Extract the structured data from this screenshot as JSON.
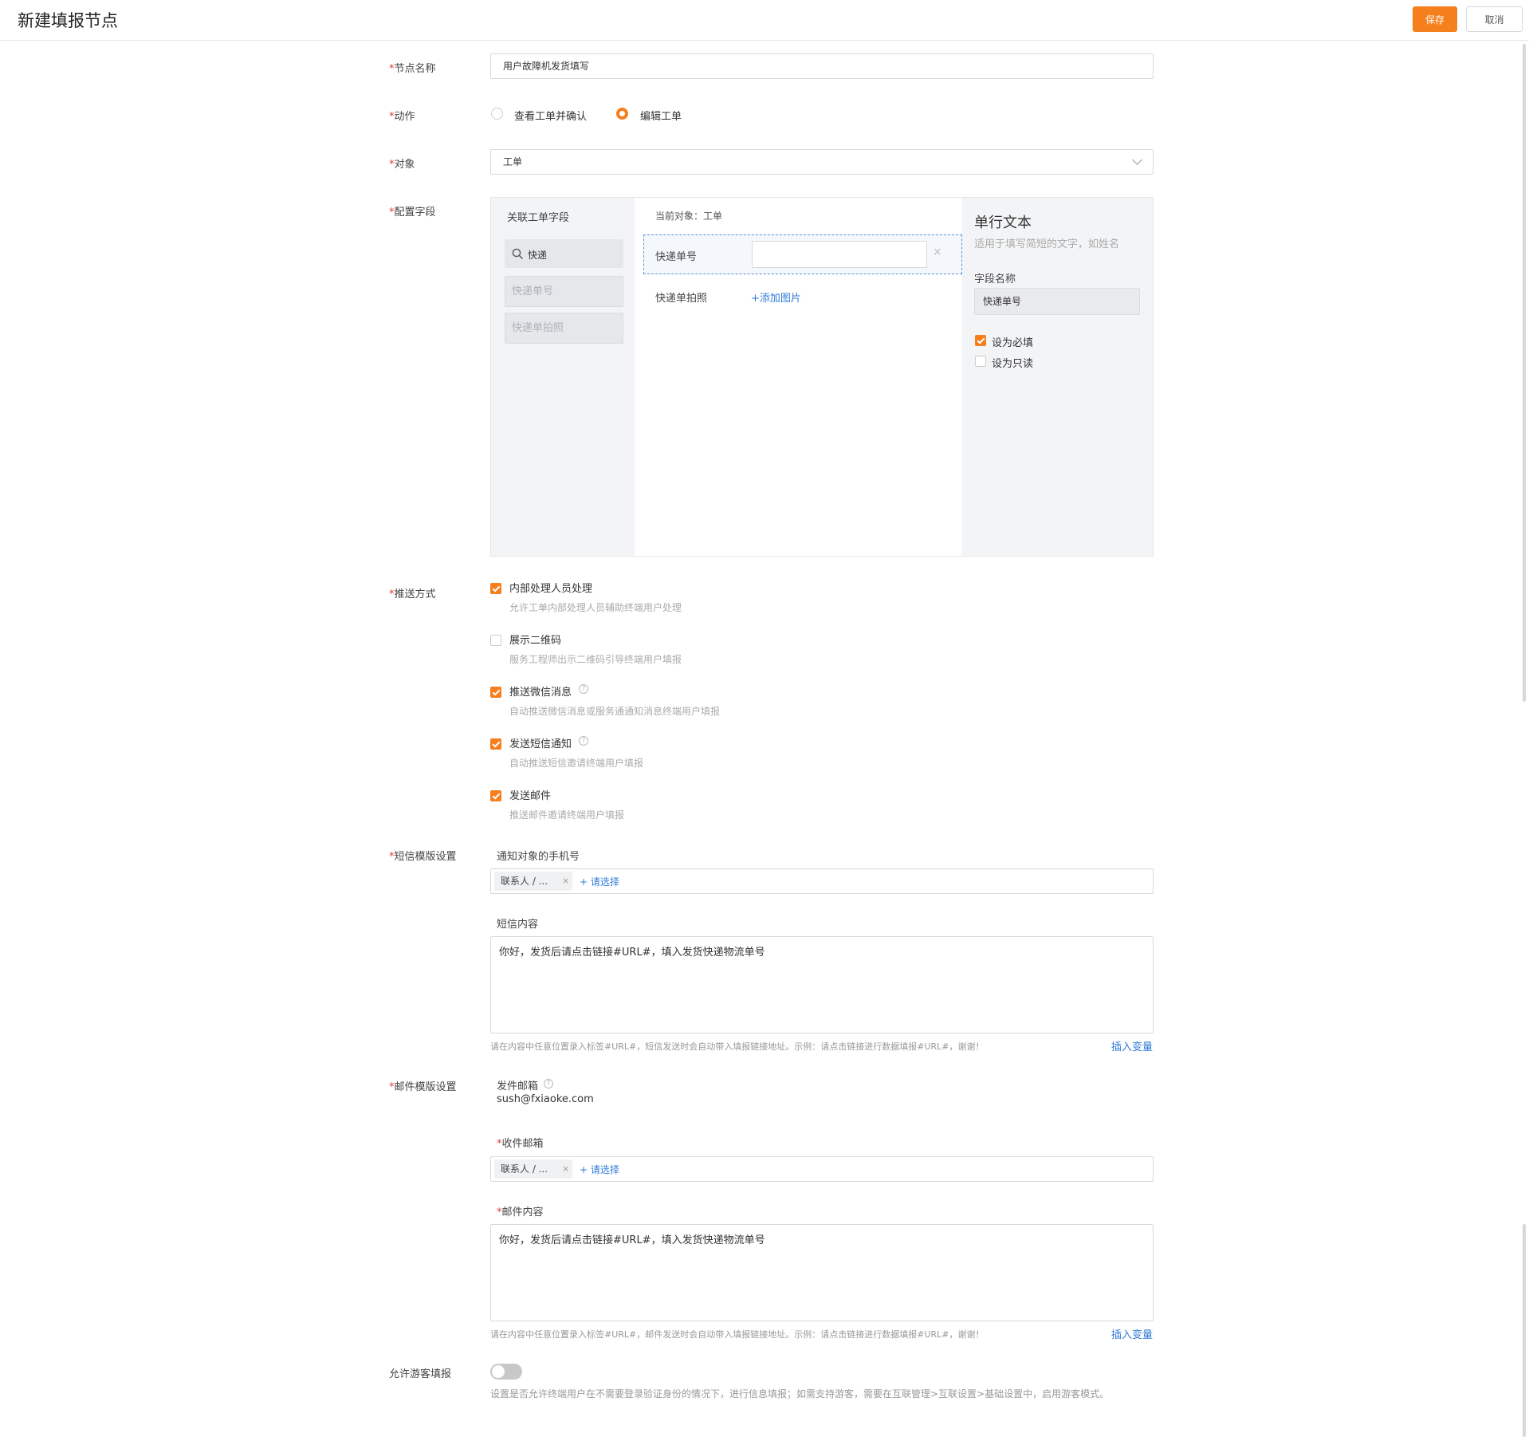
{
  "header": {
    "title": "新建填报节点",
    "save_label": "保存",
    "cancel_label": "取消"
  },
  "form": {
    "node_name": {
      "label": "节点名称",
      "value": "用户故障机发货填写"
    },
    "action": {
      "label": "动作",
      "options": [
        {
          "label": "查看工单并确认",
          "selected": false
        },
        {
          "label": "编辑工单",
          "selected": true
        }
      ]
    },
    "object": {
      "label": "对象",
      "value": "工单"
    },
    "config_fields": {
      "label": "配置字段",
      "left": {
        "title": "关联工单字段",
        "search_value": "快递",
        "items": [
          "快递单号",
          "快递单拍照"
        ]
      },
      "middle": {
        "current_object": "当前对象：工单",
        "rows": [
          {
            "label": "快递单号",
            "selected": true
          },
          {
            "label": "快递单拍照",
            "action": "+添加图片"
          }
        ]
      },
      "right": {
        "title": "单行文本",
        "description": "适用于填写简短的文字，如姓名",
        "field_name_label": "字段名称",
        "field_name_value": "快递单号",
        "required_label": "设为必填",
        "required_checked": true,
        "readonly_label": "设为只读",
        "readonly_checked": false
      }
    },
    "push": {
      "label": "推送方式",
      "options": [
        {
          "label": "内部处理人员处理",
          "desc": "允许工单内部处理人员辅助终端用户处理",
          "checked": true,
          "help": false
        },
        {
          "label": "展示二维码",
          "desc": "服务工程师出示二维码引导终端用户填报",
          "checked": false,
          "help": false
        },
        {
          "label": "推送微信消息",
          "desc": "自动推送微信消息或服务通通知消息终端用户填报",
          "checked": true,
          "help": true
        },
        {
          "label": "发送短信通知",
          "desc": "自动推送短信邀请终端用户填报",
          "checked": true,
          "help": true
        },
        {
          "label": "发送邮件",
          "desc": "推送邮件邀请终端用户填报",
          "checked": true,
          "help": false
        }
      ]
    },
    "sms": {
      "label": "短信模版设置",
      "phone_label": "通知对象的手机号",
      "tag": "联系人 / ...",
      "add_label": "+ 请选择",
      "content_label": "短信内容",
      "content": "你好，发货后请点击链接#URL#，填入发货快递物流单号",
      "hint": "请在内容中任意位置录入标签#URL#，短信发送时会自动带入填报链接地址。示例：请点击链接进行数据填报#URL#，谢谢！",
      "insert_var": "插入变量"
    },
    "email": {
      "label": "邮件模版设置",
      "sender_label": "发件邮箱",
      "sender_value": "sush@fxiaoke.com",
      "recipient_label": "收件邮箱",
      "tag": "联系人 / ...",
      "add_label": "+ 请选择",
      "content_label": "邮件内容",
      "content": "你好，发货后请点击链接#URL#，填入发货快递物流单号",
      "hint": "请在内容中任意位置录入标签#URL#，邮件发送时会自动带入填报链接地址。示例：请点击链接进行数据填报#URL#，谢谢！",
      "insert_var": "插入变量"
    },
    "guest": {
      "label": "允许游客填报",
      "enabled": false,
      "desc": "设置是否允许终端用户在不需要登录验证身份的情况下，进行信息填报；如需支持游客，需要在互联管理>互联设置>基础设置中，启用游客模式。"
    }
  }
}
